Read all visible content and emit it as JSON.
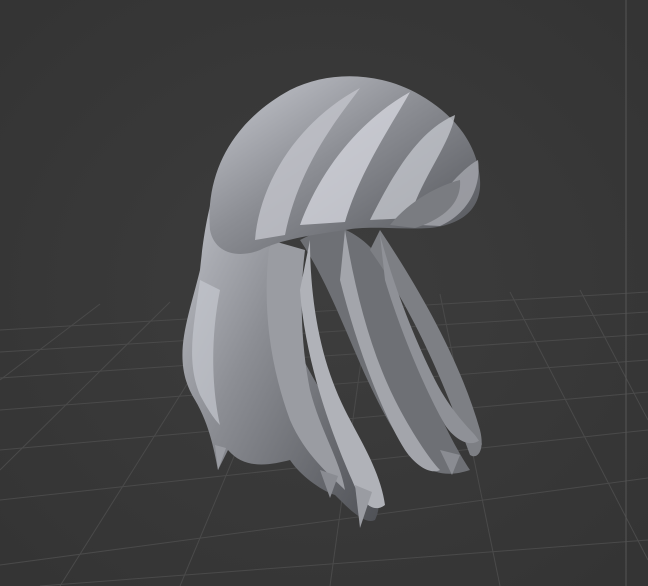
{
  "viewport": {
    "background_color": "#3a3a3a",
    "grid_color": "#4a4a4a",
    "axis_line_color": "#555555",
    "mesh_base_color": "#8a8c92",
    "mesh_highlight_color": "#c9cbd2",
    "mesh_shadow_color": "#55575c"
  },
  "scene": {
    "object_icon": "hair-mesh-icon",
    "shading": "solid"
  }
}
